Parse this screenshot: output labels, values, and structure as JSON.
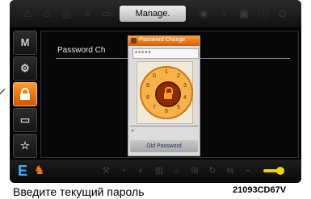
{
  "header": {
    "title": "Manage."
  },
  "sidebar": {
    "items": [
      {
        "label": "M",
        "icon": "m-letter-icon"
      },
      {
        "label": "⚙",
        "icon": "gear-icon"
      },
      {
        "label": "🔒",
        "icon": "lock-icon"
      },
      {
        "label": "▭",
        "icon": "case-icon"
      },
      {
        "label": "☆",
        "icon": "star-icon"
      }
    ]
  },
  "main": {
    "password_label": "Password Ch"
  },
  "dialog": {
    "title": "Password Change",
    "password_field": "*****",
    "dial_keys": [
      "1",
      "2",
      "3",
      "4",
      "5",
      "6",
      "7",
      "8",
      "9",
      "0"
    ],
    "old_password_button": "Old Password",
    "arrow": "»"
  },
  "bottombar": {
    "mode_letter": "E"
  },
  "caption": "Введите текущий пароль",
  "figure_code": "21093CD67V"
}
